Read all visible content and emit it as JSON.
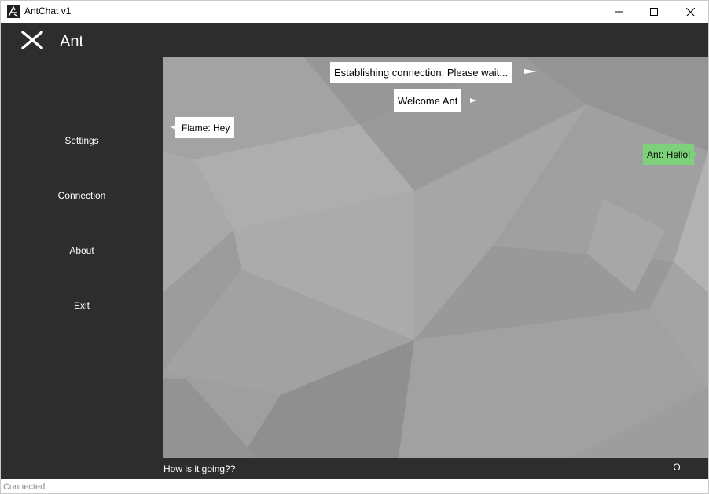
{
  "window": {
    "title": "AntChat v1",
    "minimize_icon": "minimize-icon",
    "maximize_icon": "maximize-icon",
    "close_icon": "close-icon"
  },
  "header": {
    "menu_icon": "close-menu-icon",
    "title": "Ant"
  },
  "sidebar": {
    "items": [
      {
        "label": "Settings"
      },
      {
        "label": "Connection"
      },
      {
        "label": "About"
      },
      {
        "label": "Exit"
      }
    ]
  },
  "chat": {
    "messages": [
      {
        "text": "Establishing connection. Please wait...",
        "kind": "system"
      },
      {
        "text": "Welcome Ant",
        "kind": "system"
      },
      {
        "text": "Flame: Hey",
        "kind": "incoming"
      },
      {
        "text": "Ant: Hello!",
        "kind": "outgoing"
      }
    ],
    "colors": {
      "incoming_bubble": "#ffffff",
      "outgoing_bubble": "#7ed07a",
      "background": "#9b9b9b"
    }
  },
  "composer": {
    "value": "How is it going??",
    "send_label": "O"
  },
  "status": {
    "text": "Connected"
  },
  "colors": {
    "dark_panel": "#2d2d2d",
    "text_light": "#ffffff"
  }
}
